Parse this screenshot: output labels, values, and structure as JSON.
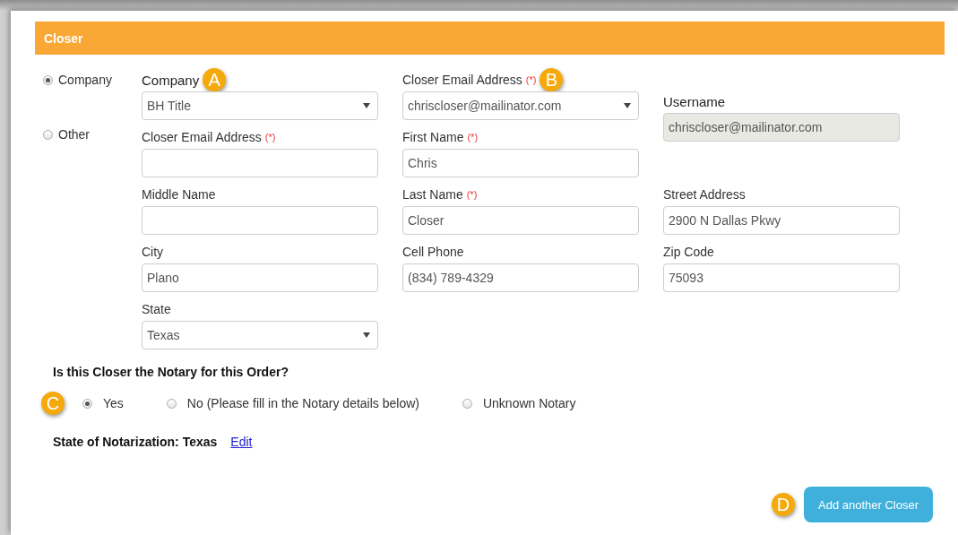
{
  "section": {
    "title": "Closer"
  },
  "source_options": [
    {
      "label": "Company",
      "selected": true
    },
    {
      "label": "Other",
      "selected": false
    }
  ],
  "company": {
    "label": "Company",
    "badge": "A",
    "value": "BH Title"
  },
  "closer_email_select": {
    "label": "Closer Email Address",
    "required_mark": "(*)",
    "badge": "B",
    "value": "chriscloser@mailinator.com"
  },
  "username": {
    "label": "Username",
    "value": "chriscloser@mailinator.com",
    "disabled": true
  },
  "closer_email_input": {
    "label": "Closer Email Address",
    "required_mark": "(*)"
  },
  "fields": [
    {
      "label": "First Name",
      "required_mark": "(*)",
      "value": "Chris",
      "kind": "text"
    },
    {
      "label": "Middle Name",
      "kind": "text"
    },
    {
      "label": "Last Name",
      "required_mark": "(*)",
      "value": "Closer",
      "kind": "text"
    },
    {
      "label": "Street Address",
      "value": "2900 N Dallas Pkwy",
      "kind": "text"
    },
    {
      "label": "City",
      "value": "Plano",
      "kind": "text"
    },
    {
      "label": "Cell Phone",
      "value": "(834) 789-4329",
      "kind": "text"
    },
    {
      "label": "Zip Code",
      "value": "75093",
      "kind": "text"
    },
    {
      "label": "State",
      "value": "Texas",
      "kind": "select"
    }
  ],
  "notary": {
    "question": "Is this Closer the Notary for this Order?",
    "badge": "C",
    "options": [
      {
        "label": "Yes",
        "selected": true
      },
      {
        "label": "No (Please fill in the Notary details below)",
        "selected": false
      },
      {
        "label": "Unknown Notary",
        "selected": false
      }
    ]
  },
  "state_of_notarization": {
    "text": "State of Notarization: Texas",
    "link": "Edit"
  },
  "add_button": {
    "badge": "D",
    "label": "Add another Closer"
  }
}
